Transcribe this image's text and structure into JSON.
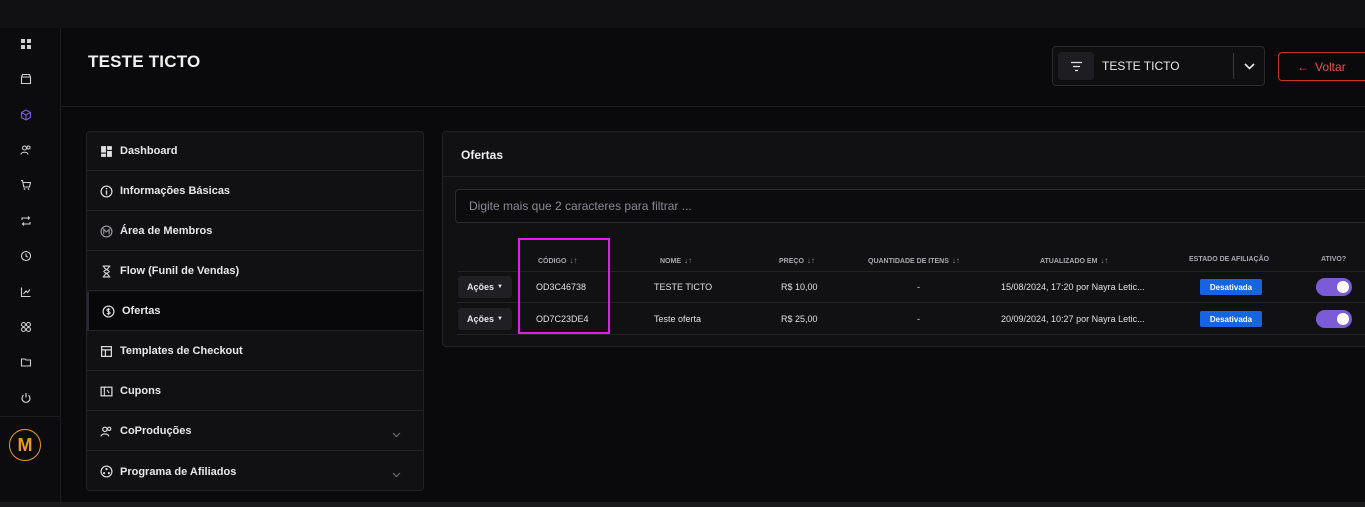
{
  "header": {
    "title": "TESTE TICTO",
    "selector_value": "TESTE TICTO",
    "back_label": "Voltar"
  },
  "rail": {
    "icons": [
      "grid-icon",
      "store-icon",
      "box-icon",
      "users-icon",
      "cart-icon",
      "repeat-icon",
      "history-icon",
      "chart-icon",
      "apps-icon",
      "folder-icon",
      "power-icon"
    ],
    "logo": "M"
  },
  "menu": {
    "items": [
      {
        "label": "Dashboard",
        "icon": "grid-icon"
      },
      {
        "label": "Informações Básicas",
        "icon": "info-icon"
      },
      {
        "label": "Área de Membros",
        "icon": "members-icon"
      },
      {
        "label": "Flow (Funil de Vendas)",
        "icon": "hourglass-icon"
      },
      {
        "label": "Ofertas",
        "icon": "dollar-icon"
      },
      {
        "label": "Templates de Checkout",
        "icon": "layout-icon"
      },
      {
        "label": "Cupons",
        "icon": "coupon-icon"
      },
      {
        "label": "CoProduções",
        "icon": "users-icon"
      },
      {
        "label": "Programa de Afiliados",
        "icon": "affiliate-icon"
      }
    ],
    "active_index": 4
  },
  "offers": {
    "title": "Ofertas",
    "search_placeholder": "Digite mais que 2 caracteres para filtrar ...",
    "columns": [
      "CÓDIGO",
      "NOME",
      "PREÇO",
      "QUANTIDADE DE ITENS",
      "ATUALIZADO EM",
      "ESTADO DE AFILIAÇÃO",
      "ATIVO?"
    ],
    "sort_glyph": "↓↑",
    "rows": [
      {
        "actions": "Ações",
        "code": "OD3C46738",
        "name": "TESTE TICTO",
        "price": "R$ 10,00",
        "qty": "-",
        "updated": "15/08/2024, 17:20 por Nayra Letic...",
        "status": "Desativada",
        "active": true
      },
      {
        "actions": "Ações",
        "code": "OD7C23DE4",
        "name": "Teste oferta",
        "price": "R$ 25,00",
        "qty": "-",
        "updated": "20/09/2024, 10:27 por Nayra Letic...",
        "status": "Desativada",
        "active": true
      }
    ]
  },
  "colors": {
    "accent": "#7b5bd6",
    "badge": "#1565e0",
    "highlight": "#e020e8",
    "back": "#e0544a",
    "logo": "#e59a2b"
  }
}
